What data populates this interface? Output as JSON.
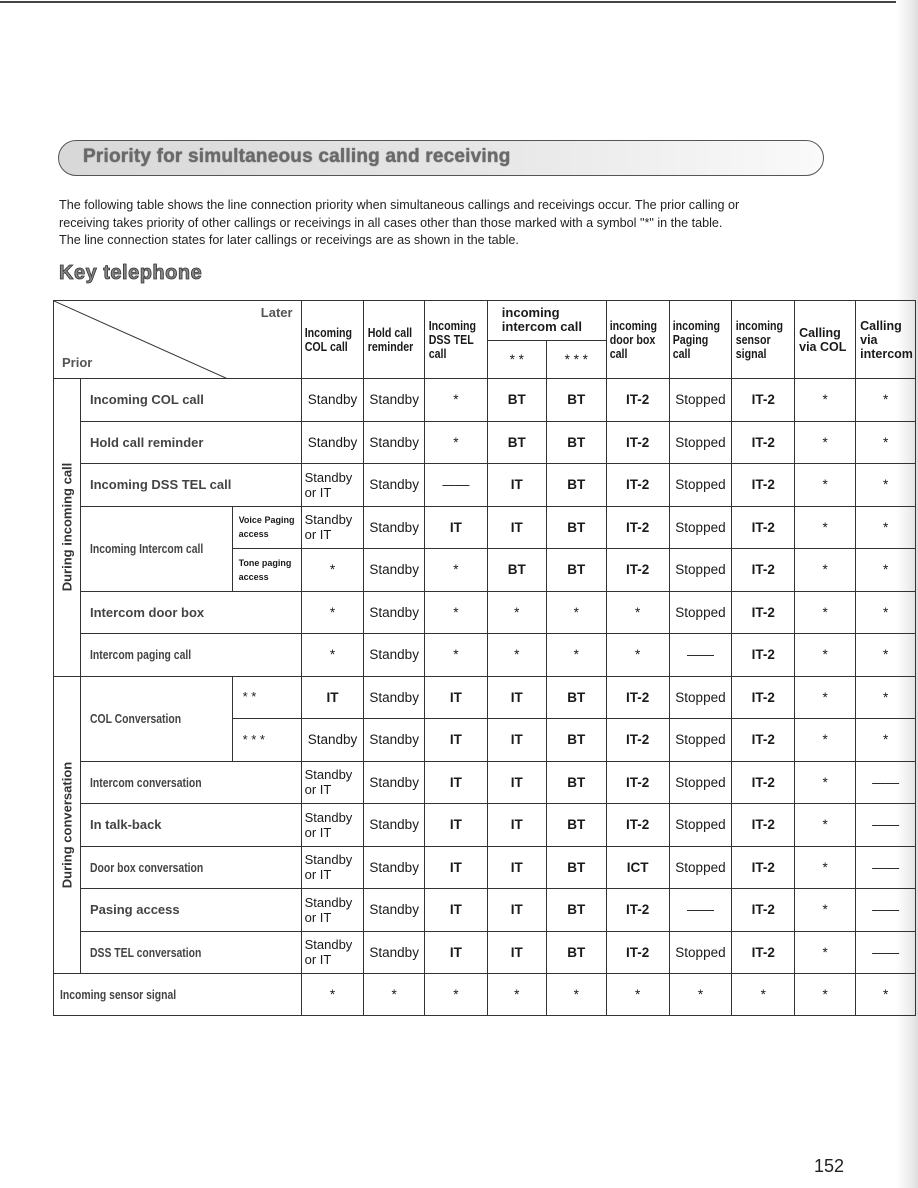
{
  "title": "Priority for simultaneous calling and receiving",
  "intro": [
    "The following table shows the line connection priority when simultaneous callings and receivings occur. The prior calling or",
    "receiving takes priority of other callings or receivings in all cases other than those marked with a symbol \"*\" in the table.",
    "The line connection states for later callings or receivings are as shown in the table."
  ],
  "section_heading": "Key telephone",
  "table": {
    "corner_later": "Later",
    "corner_prior": "Prior",
    "columns": [
      "Incoming COL call",
      "Hold call reminder",
      "Incoming DSS TEL call",
      "incoming intercom call",
      "incoming door box call",
      "incoming Paging call",
      "incoming sensor signal",
      "Calling via COL",
      "Calling via intercom"
    ],
    "intercom_subcolumns": [
      "* *",
      "* * *"
    ],
    "groups": [
      {
        "label": "During incoming call",
        "rows": [
          {
            "label": "Incoming COL call",
            "cells": [
              "Standby",
              "Standby",
              "*",
              "BT",
              "BT",
              "IT-2",
              "Stopped",
              "IT-2",
              "*",
              "*"
            ]
          },
          {
            "label": "Hold call reminder",
            "cells": [
              "Standby",
              "Standby",
              "*",
              "BT",
              "BT",
              "IT-2",
              "Stopped",
              "IT-2",
              "*",
              "*"
            ]
          },
          {
            "label": "Incoming DSS TEL call",
            "cells": [
              "Standby or IT",
              "Standby",
              "——",
              "IT",
              "BT",
              "IT-2",
              "Stopped",
              "IT-2",
              "*",
              "*"
            ]
          },
          {
            "label": "Incoming Intercom call",
            "sublabel": "Voice Paging access",
            "cells": [
              "Standby or IT",
              "Standby",
              "IT",
              "IT",
              "BT",
              "IT-2",
              "Stopped",
              "IT-2",
              "*",
              "*"
            ]
          },
          {
            "label": "Incoming Intercom call",
            "sublabel": "Tone paging access",
            "cells": [
              "*",
              "Standby",
              "*",
              "BT",
              "BT",
              "IT-2",
              "Stopped",
              "IT-2",
              "*",
              "*"
            ]
          },
          {
            "label": "Intercom door box",
            "cells": [
              "*",
              "Standby",
              "*",
              "*",
              "*",
              "*",
              "Stopped",
              "IT-2",
              "*",
              "*"
            ]
          },
          {
            "label": "Intercom paging call",
            "cells": [
              "*",
              "Standby",
              "*",
              "*",
              "*",
              "*",
              "——",
              "IT-2",
              "*",
              "*"
            ]
          }
        ]
      },
      {
        "label": "During conversation",
        "rows": [
          {
            "label": "COL Conversation",
            "sublabel": "* *",
            "cells": [
              "IT",
              "Standby",
              "IT",
              "IT",
              "BT",
              "IT-2",
              "Stopped",
              "IT-2",
              "*",
              "*"
            ]
          },
          {
            "label": "COL Conversation",
            "sublabel": "* * *",
            "cells": [
              "Standby",
              "Standby",
              "IT",
              "IT",
              "BT",
              "IT-2",
              "Stopped",
              "IT-2",
              "*",
              "*"
            ]
          },
          {
            "label": "Intercom conversation",
            "cells": [
              "Standby or IT",
              "Standby",
              "IT",
              "IT",
              "BT",
              "IT-2",
              "Stopped",
              "IT-2",
              "*",
              "——"
            ]
          },
          {
            "label": "In talk-back",
            "cells": [
              "Standby or IT",
              "Standby",
              "IT",
              "IT",
              "BT",
              "IT-2",
              "Stopped",
              "IT-2",
              "*",
              "——"
            ]
          },
          {
            "label": "Door box conversation",
            "cells": [
              "Standby or IT",
              "Standby",
              "IT",
              "IT",
              "BT",
              "ICT",
              "Stopped",
              "IT-2",
              "*",
              "——"
            ]
          },
          {
            "label": "Pasing access",
            "cells": [
              "Standby or IT",
              "Standby",
              "IT",
              "IT",
              "BT",
              "IT-2",
              "——",
              "IT-2",
              "*",
              "——"
            ]
          },
          {
            "label": "DSS TEL conversation",
            "cells": [
              "Standby or IT",
              "Standby",
              "IT",
              "IT",
              "BT",
              "IT-2",
              "Stopped",
              "IT-2",
              "*",
              "——"
            ]
          }
        ]
      }
    ],
    "footer_row": {
      "label": "Incoming sensor signal",
      "cells": [
        "*",
        "*",
        "*",
        "*",
        "*",
        "*",
        "*",
        "*",
        "*",
        "*"
      ]
    }
  },
  "page_number": "152"
}
